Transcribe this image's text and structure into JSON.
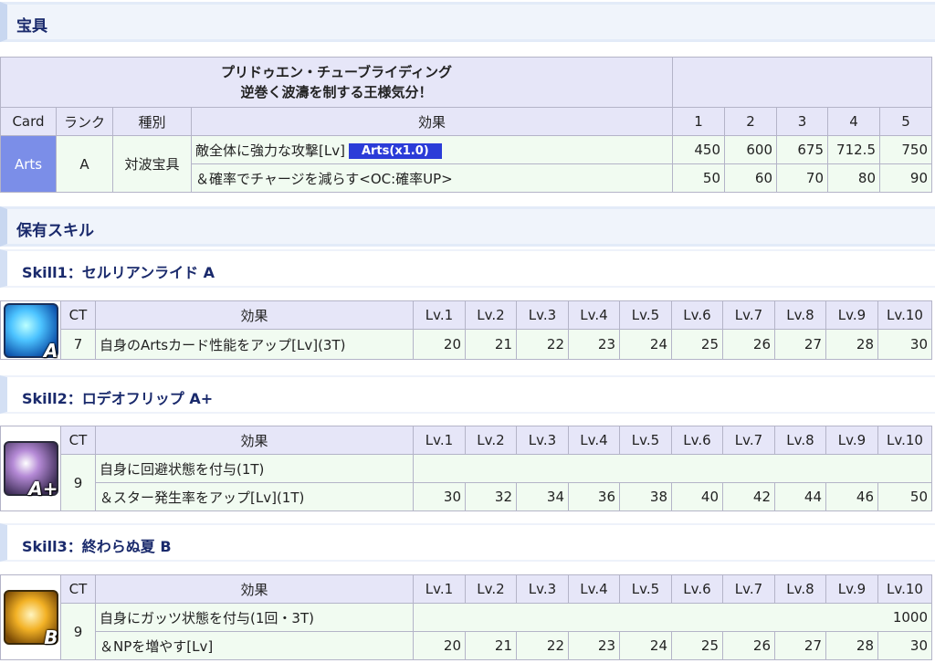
{
  "np_section": {
    "title": "宝具"
  },
  "np_table": {
    "name_line1": "プリドゥエン・チューブライディング",
    "name_line2": "逆巻く波濤を制する王様気分！",
    "headers": {
      "card": "Card",
      "rank": "ランク",
      "type": "種別",
      "effect": "効果",
      "levels": [
        "1",
        "2",
        "3",
        "4",
        "5"
      ]
    },
    "card": "Arts",
    "rank": "A",
    "type": "対波宝具",
    "rows": [
      {
        "effect": "敵全体に強力な攻撃[Lv]",
        "badge": "Arts(x1.0)",
        "values": [
          "450",
          "600",
          "675",
          "712.5",
          "750"
        ]
      },
      {
        "effect": "＆確率でチャージを減らす<OC:確率UP>",
        "values": [
          "50",
          "60",
          "70",
          "80",
          "90"
        ]
      }
    ]
  },
  "skills_section": {
    "title": "保有スキル"
  },
  "skill_headers": {
    "ct": "CT",
    "effect": "効果",
    "levels": [
      "Lv.1",
      "Lv.2",
      "Lv.3",
      "Lv.4",
      "Lv.5",
      "Lv.6",
      "Lv.7",
      "Lv.8",
      "Lv.9",
      "Lv.10"
    ]
  },
  "skills": [
    {
      "title": "Skill1：セルリアンライド A",
      "icon": "arts-up-icon",
      "rank": "A",
      "ct": "7",
      "rows": [
        {
          "effect": "自身のArtsカード性能をアップ[Lv](3T)",
          "values": [
            "20",
            "21",
            "22",
            "23",
            "24",
            "25",
            "26",
            "27",
            "28",
            "30"
          ]
        }
      ]
    },
    {
      "title": "Skill2：ロデオフリップ A+",
      "icon": "evasion-icon",
      "rank": "A+",
      "ct": "9",
      "rows": [
        {
          "effect": "自身に回避状態を付与(1T)",
          "values": []
        },
        {
          "effect": "＆スター発生率をアップ[Lv](1T)",
          "values": [
            "30",
            "32",
            "34",
            "36",
            "38",
            "40",
            "42",
            "44",
            "46",
            "50"
          ]
        }
      ]
    },
    {
      "title": "Skill3：終わらぬ夏 B",
      "icon": "guts-icon",
      "rank": "B",
      "ct": "9",
      "rows": [
        {
          "effect": "自身にガッツ状態を付与(1回・3T)",
          "single": "1000"
        },
        {
          "effect": "＆NPを増やす[Lv]",
          "values": [
            "20",
            "21",
            "22",
            "23",
            "24",
            "25",
            "26",
            "27",
            "28",
            "30"
          ]
        }
      ]
    }
  ]
}
